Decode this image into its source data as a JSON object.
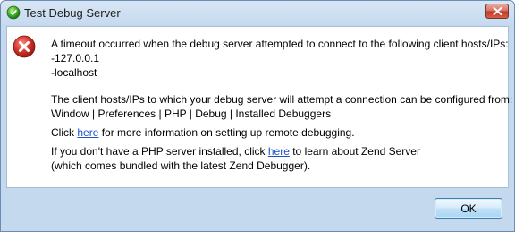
{
  "window": {
    "title": "Test Debug Server",
    "colors": {
      "title_bar": "#c4d8ee",
      "close_button": "#c0392b",
      "error_icon": "#d0342c",
      "link": "#1e52c8"
    }
  },
  "message": {
    "line1": "A timeout occurred when the debug server attempted to connect to the following client hosts/IPs:",
    "line2": "-127.0.0.1",
    "line3": "-localhost",
    "line4": "The client hosts/IPs to which your debug server will attempt a connection can be configured from:",
    "line5": "Window | Preferences | PHP | Debug | Installed Debuggers",
    "line6_pre": "Click ",
    "line6_link": "here",
    "line6_post": " for more information on setting up remote debugging.",
    "line7_pre": "If you don't have a PHP server installed, click ",
    "line7_link": "here",
    "line7_post": " to learn about Zend Server",
    "line8": "(which comes bundled with the latest Zend Debugger)."
  },
  "buttons": {
    "ok": "OK"
  },
  "icons": {
    "app": "eclipse-green-circle-icon",
    "close": "close-x-icon",
    "error": "error-icon"
  }
}
